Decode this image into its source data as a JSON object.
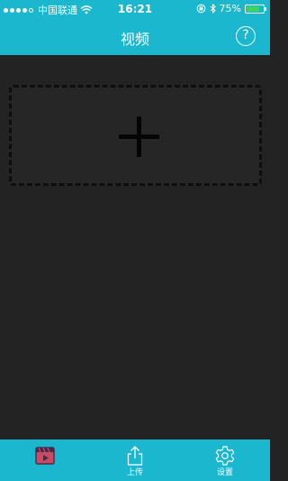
{
  "colors": {
    "accent": "#1bb7cf",
    "background": "#232323",
    "battery": "#3fd35a"
  },
  "status_bar": {
    "carrier": "中国联通",
    "time": "16:21",
    "battery_percent": "75%",
    "battery_level": 0.75,
    "icons": [
      "signal-dots-icon",
      "wifi-icon",
      "orientation-lock-icon",
      "bluetooth-icon",
      "battery-icon"
    ]
  },
  "nav": {
    "title": "视频",
    "help_label": "?",
    "help_icon": "question-circle-icon"
  },
  "main": {
    "add_icon": "plus-icon"
  },
  "tabs": [
    {
      "label": "",
      "icon": "video-clapper-icon",
      "selected": true
    },
    {
      "label": "上传",
      "icon": "upload-icon",
      "selected": false
    },
    {
      "label": "设置",
      "icon": "gear-icon",
      "selected": false
    }
  ]
}
